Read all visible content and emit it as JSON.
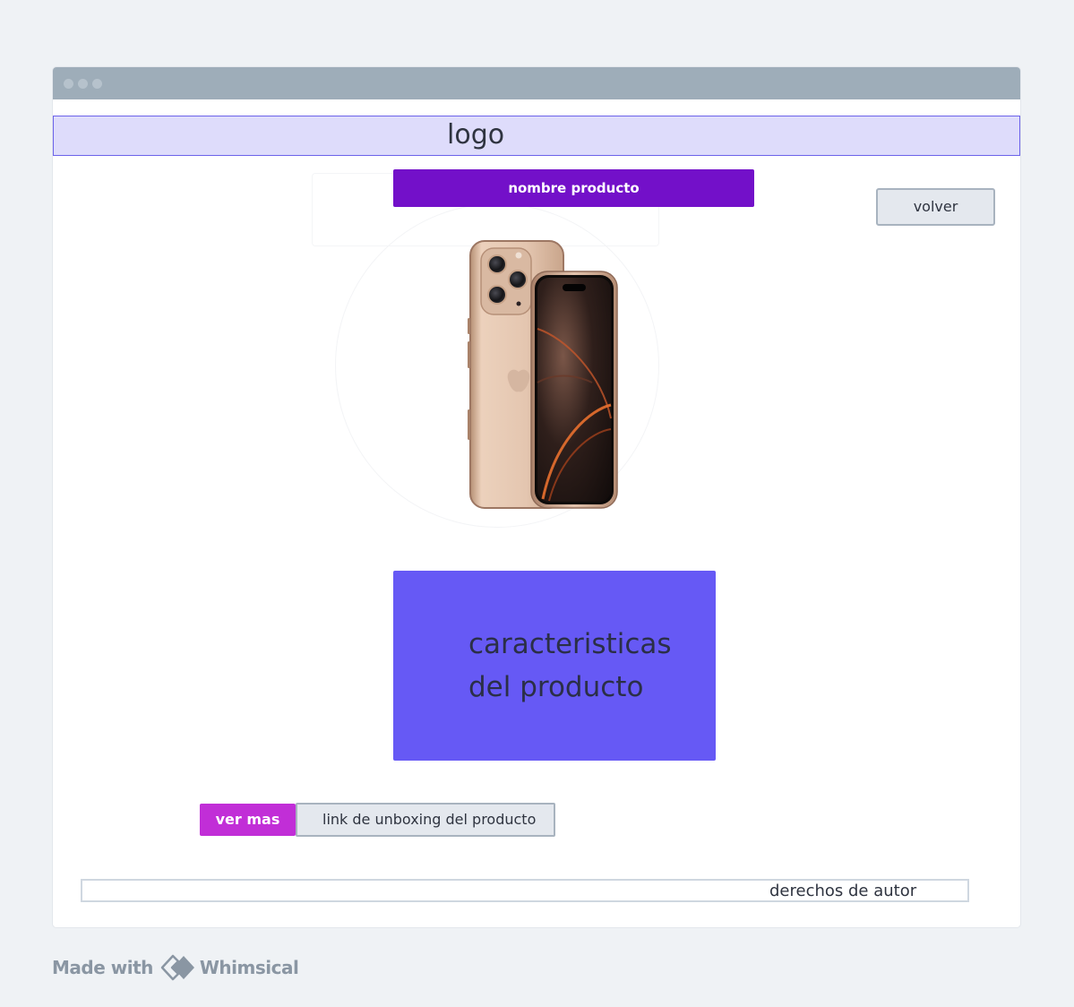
{
  "header": {
    "logo_text": "logo"
  },
  "product": {
    "name_label": "nombre producto",
    "image_name": "iphone-product-image",
    "features_line1": "caracteristicas",
    "features_line2": "del producto"
  },
  "actions": {
    "back_label": "volver",
    "more_label": "ver mas",
    "unboxing_label": "link de unboxing  del producto"
  },
  "footer": {
    "copyright_label": "derechos de autor"
  },
  "branding": {
    "made_with_label": "Made with",
    "brand_name": "Whimsical"
  },
  "colors": {
    "logo_bar_fill": "#dedcfb",
    "logo_bar_border": "#6c63ea",
    "name_button": "#7310c9",
    "features_box": "#6659f5",
    "more_button": "#c12ed7",
    "secondary_button": "#e4e8ee",
    "window_titlebar": "#9eadb9",
    "background": "#eff2f5"
  }
}
